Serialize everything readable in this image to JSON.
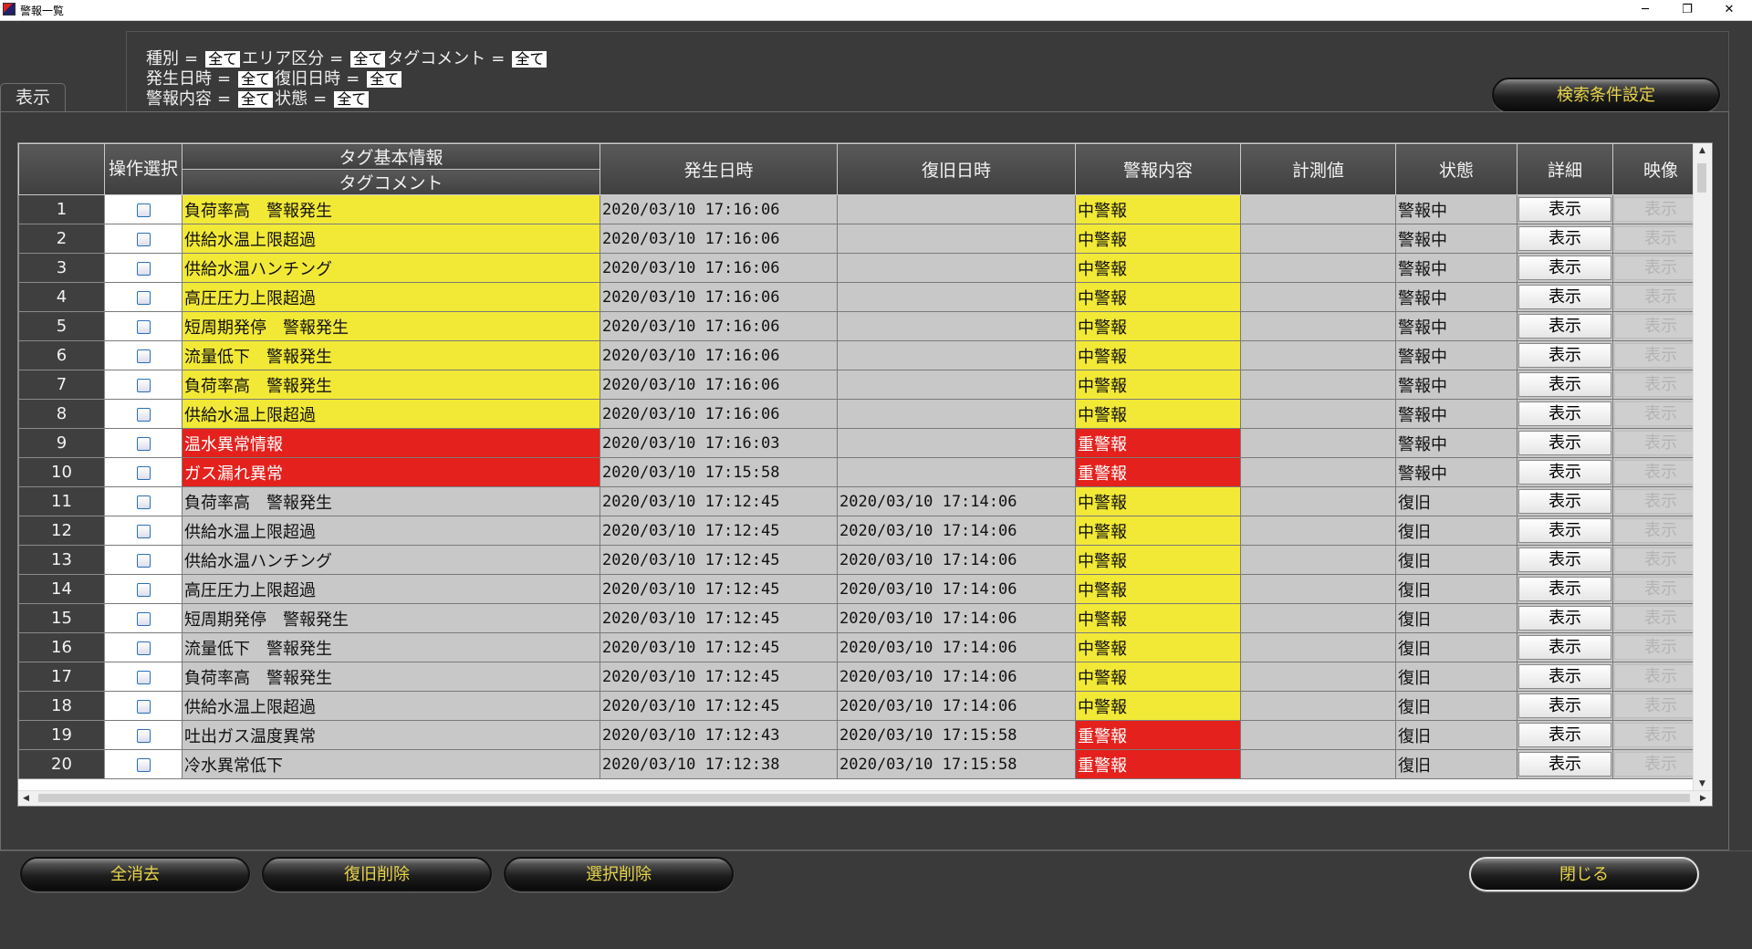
{
  "window": {
    "title": "警報一覧",
    "minimize_glyph": "─",
    "restore_glyph": "❐",
    "close_glyph": "✕"
  },
  "tab": {
    "label": "表示"
  },
  "conditions": {
    "line1": [
      {
        "label": "種別",
        "value": "全て"
      },
      {
        "label": "エリア区分",
        "value": "全て"
      },
      {
        "label": "タグコメント",
        "value": "全て"
      }
    ],
    "line2": [
      {
        "label": "発生日時",
        "value": "全て"
      },
      {
        "label": "復旧日時",
        "value": "全て"
      }
    ],
    "line3": [
      {
        "label": "警報内容",
        "value": "全て"
      },
      {
        "label": "状態",
        "value": "全て"
      }
    ],
    "equals": "="
  },
  "buttons": {
    "search_settings": "検索条件設定",
    "clear_all": "全消去",
    "delete_recovered": "復旧削除",
    "delete_selected": "選択削除",
    "close": "閉じる"
  },
  "table": {
    "headers": {
      "no": "",
      "select": "操作選択",
      "tag_info": "タグ基本情報",
      "tag_comment": "タグコメント",
      "occurred": "発生日時",
      "recovered": "復旧日時",
      "alarm": "警報内容",
      "measured": "計測値",
      "status": "状態",
      "detail": "詳細",
      "video": "映像"
    },
    "button_label": "表示",
    "colors": {
      "yellow": "#f2e936",
      "red": "#e4211c",
      "gray": "#c8c8c8"
    },
    "rows": [
      {
        "no": "1",
        "comment": "負荷率高　警報発生",
        "occurred": "2020/03/10 17:16:06",
        "recovered": "",
        "alarm": "中警報",
        "measured": "",
        "status": "警報中",
        "hl": "yel"
      },
      {
        "no": "2",
        "comment": "供給水温上限超過",
        "occurred": "2020/03/10 17:16:06",
        "recovered": "",
        "alarm": "中警報",
        "measured": "",
        "status": "警報中",
        "hl": "yel"
      },
      {
        "no": "3",
        "comment": "供給水温ハンチング",
        "occurred": "2020/03/10 17:16:06",
        "recovered": "",
        "alarm": "中警報",
        "measured": "",
        "status": "警報中",
        "hl": "yel"
      },
      {
        "no": "4",
        "comment": "高圧圧力上限超過",
        "occurred": "2020/03/10 17:16:06",
        "recovered": "",
        "alarm": "中警報",
        "measured": "",
        "status": "警報中",
        "hl": "yel"
      },
      {
        "no": "5",
        "comment": "短周期発停　警報発生",
        "occurred": "2020/03/10 17:16:06",
        "recovered": "",
        "alarm": "中警報",
        "measured": "",
        "status": "警報中",
        "hl": "yel"
      },
      {
        "no": "6",
        "comment": "流量低下　警報発生",
        "occurred": "2020/03/10 17:16:06",
        "recovered": "",
        "alarm": "中警報",
        "measured": "",
        "status": "警報中",
        "hl": "yel"
      },
      {
        "no": "7",
        "comment": "負荷率高　警報発生",
        "occurred": "2020/03/10 17:16:06",
        "recovered": "",
        "alarm": "中警報",
        "measured": "",
        "status": "警報中",
        "hl": "yel"
      },
      {
        "no": "8",
        "comment": "供給水温上限超過",
        "occurred": "2020/03/10 17:16:06",
        "recovered": "",
        "alarm": "中警報",
        "measured": "",
        "status": "警報中",
        "hl": "yel"
      },
      {
        "no": "9",
        "comment": "温水異常情報",
        "occurred": "2020/03/10 17:16:03",
        "recovered": "",
        "alarm": "重警報",
        "measured": "",
        "status": "警報中",
        "hl": "red"
      },
      {
        "no": "10",
        "comment": "ガス漏れ異常",
        "occurred": "2020/03/10 17:15:58",
        "recovered": "",
        "alarm": "重警報",
        "measured": "",
        "status": "警報中",
        "hl": "red"
      },
      {
        "no": "11",
        "comment": "負荷率高　警報発生",
        "occurred": "2020/03/10 17:12:45",
        "recovered": "2020/03/10 17:14:06",
        "alarm": "中警報",
        "measured": "",
        "status": "復旧",
        "hl": "none"
      },
      {
        "no": "12",
        "comment": "供給水温上限超過",
        "occurred": "2020/03/10 17:12:45",
        "recovered": "2020/03/10 17:14:06",
        "alarm": "中警報",
        "measured": "",
        "status": "復旧",
        "hl": "none"
      },
      {
        "no": "13",
        "comment": "供給水温ハンチング",
        "occurred": "2020/03/10 17:12:45",
        "recovered": "2020/03/10 17:14:06",
        "alarm": "中警報",
        "measured": "",
        "status": "復旧",
        "hl": "none"
      },
      {
        "no": "14",
        "comment": "高圧圧力上限超過",
        "occurred": "2020/03/10 17:12:45",
        "recovered": "2020/03/10 17:14:06",
        "alarm": "中警報",
        "measured": "",
        "status": "復旧",
        "hl": "none"
      },
      {
        "no": "15",
        "comment": "短周期発停　警報発生",
        "occurred": "2020/03/10 17:12:45",
        "recovered": "2020/03/10 17:14:06",
        "alarm": "中警報",
        "measured": "",
        "status": "復旧",
        "hl": "none"
      },
      {
        "no": "16",
        "comment": "流量低下　警報発生",
        "occurred": "2020/03/10 17:12:45",
        "recovered": "2020/03/10 17:14:06",
        "alarm": "中警報",
        "measured": "",
        "status": "復旧",
        "hl": "none"
      },
      {
        "no": "17",
        "comment": "負荷率高　警報発生",
        "occurred": "2020/03/10 17:12:45",
        "recovered": "2020/03/10 17:14:06",
        "alarm": "中警報",
        "measured": "",
        "status": "復旧",
        "hl": "none"
      },
      {
        "no": "18",
        "comment": "供給水温上限超過",
        "occurred": "2020/03/10 17:12:45",
        "recovered": "2020/03/10 17:14:06",
        "alarm": "中警報",
        "measured": "",
        "status": "復旧",
        "hl": "none"
      },
      {
        "no": "19",
        "comment": "吐出ガス温度異常",
        "occurred": "2020/03/10 17:12:43",
        "recovered": "2020/03/10 17:15:58",
        "alarm": "重警報",
        "measured": "",
        "status": "復旧",
        "hl": "none"
      },
      {
        "no": "20",
        "comment": "冷水異常低下",
        "occurred": "2020/03/10 17:12:38",
        "recovered": "2020/03/10 17:15:58",
        "alarm": "重警報",
        "measured": "",
        "status": "復旧",
        "hl": "none"
      }
    ]
  }
}
